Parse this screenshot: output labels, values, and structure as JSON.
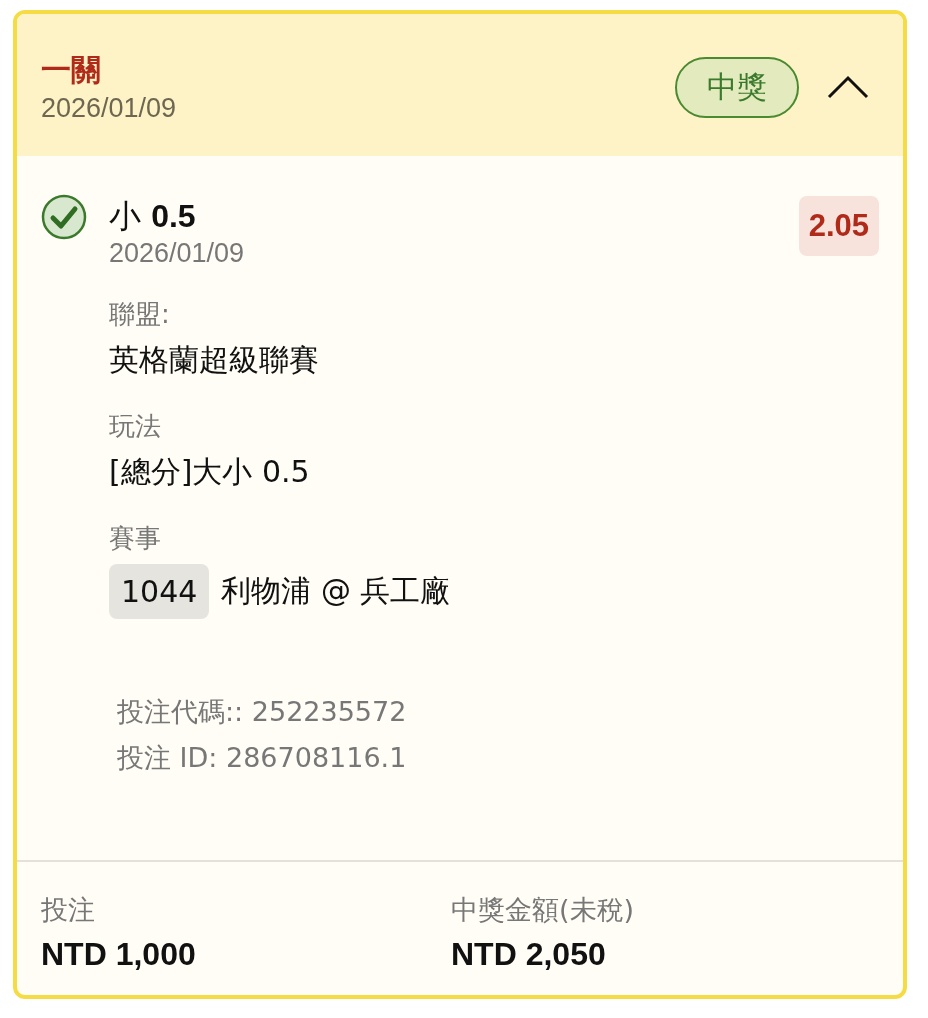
{
  "bet_card": {
    "title": "一關",
    "date": "2026/01/09",
    "status_badge": "中獎",
    "expanded": true,
    "leg": {
      "won": true,
      "selection": "小 **0.5**",
      "date": "2026/01/09",
      "odds": "2.05",
      "fields": [
        {
          "label": "聯盟:",
          "value": "英格蘭超級聯賽"
        },
        {
          "label": "玩法",
          "value": "[總分]大小 0.5"
        },
        {
          "label": "賽事",
          "match_number": "1044",
          "value": "利物浦 @ 兵工廠"
        }
      ],
      "codes": [
        "投注代碼:: 252235572",
        "投注 ID: 286708116.1"
      ]
    },
    "footer": [
      {
        "label": "投注",
        "amount": "NTD 1,000"
      },
      {
        "label": "中獎金額(未稅)",
        "amount": "NTD 2,050"
      }
    ]
  }
}
